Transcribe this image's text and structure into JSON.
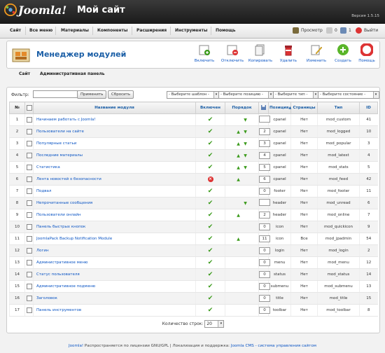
{
  "header": {
    "logo_text": "Joomla!",
    "site_title": "Мой сайт",
    "version": "Версия 1.5.15"
  },
  "menu": [
    "Сайт",
    "Все меню",
    "Материалы",
    "Компоненты",
    "Расширения",
    "Инструменты",
    "Помощь"
  ],
  "menu_right": {
    "preview": "Просмотр",
    "count0": "0",
    "count1": "1",
    "logout": "Выйти"
  },
  "toolbar": {
    "title": "Менеджер модулей",
    "buttons": [
      "Включить",
      "Отключить",
      "Копировать",
      "Удалить",
      "Изменить",
      "Создать",
      "Помощь"
    ]
  },
  "subnav": [
    "Сайт",
    "Административная панель"
  ],
  "filter": {
    "label": "Фильтр:",
    "value": "",
    "apply": "Применить",
    "reset": "Сбросить",
    "selects": [
      "- Выберите шаблон -",
      "- Выберите позицию -",
      "- Выберите тип -",
      "- Выберите состояние -"
    ]
  },
  "table": {
    "headers": {
      "num": "№",
      "name": "Название модуля",
      "enabled": "Включен",
      "order": "Порядок",
      "position": "Позиция",
      "pages": "Страницы",
      "type": "Тип",
      "id": "ID"
    },
    "rows": [
      {
        "n": "1",
        "name": "Начинаем работать с Joomla!",
        "enabled": true,
        "up": false,
        "down": true,
        "order": "",
        "position": "cpanel",
        "pages": "Нет",
        "type": "mod_custom",
        "id": "41"
      },
      {
        "n": "2",
        "name": "Пользователи на сайте",
        "enabled": true,
        "up": true,
        "down": true,
        "order": "2",
        "position": "cpanel",
        "pages": "Нет",
        "type": "mod_logged",
        "id": "10"
      },
      {
        "n": "3",
        "name": "Популярные статьи",
        "enabled": true,
        "up": true,
        "down": true,
        "order": "3",
        "position": "cpanel",
        "pages": "Нет",
        "type": "mod_popular",
        "id": "3"
      },
      {
        "n": "4",
        "name": "Последние материалы",
        "enabled": true,
        "up": true,
        "down": true,
        "order": "4",
        "position": "cpanel",
        "pages": "Нет",
        "type": "mod_latest",
        "id": "4"
      },
      {
        "n": "5",
        "name": "Статистика",
        "enabled": true,
        "up": true,
        "down": true,
        "order": "5",
        "position": "cpanel",
        "pages": "Нет",
        "type": "mod_stats",
        "id": "5"
      },
      {
        "n": "6",
        "name": "Лента новостей о безопасности",
        "enabled": false,
        "up": true,
        "down": false,
        "order": "6",
        "position": "cpanel",
        "pages": "Нет",
        "type": "mod_feed",
        "id": "42"
      },
      {
        "n": "7",
        "name": "Подвал",
        "enabled": true,
        "up": false,
        "down": false,
        "order": "0",
        "position": "footer",
        "pages": "Нет",
        "type": "mod_footer",
        "id": "11"
      },
      {
        "n": "8",
        "name": "Непрочитанные сообщения",
        "enabled": true,
        "up": false,
        "down": true,
        "order": "",
        "position": "header",
        "pages": "Нет",
        "type": "mod_unread",
        "id": "6"
      },
      {
        "n": "9",
        "name": "Пользователи онлайн",
        "enabled": true,
        "up": true,
        "down": false,
        "order": "2",
        "position": "header",
        "pages": "Нет",
        "type": "mod_online",
        "id": "7"
      },
      {
        "n": "10",
        "name": "Панель быстрых кнопок",
        "enabled": true,
        "up": false,
        "down": false,
        "order": "0",
        "position": "icon",
        "pages": "Нет",
        "type": "mod_quickicon",
        "id": "9"
      },
      {
        "n": "11",
        "name": "JoomlaPack Backup Notification Module",
        "enabled": true,
        "up": true,
        "down": false,
        "order": "11",
        "position": "icon",
        "pages": "Все",
        "type": "mod_jpadmin",
        "id": "54"
      },
      {
        "n": "12",
        "name": "Логин",
        "enabled": true,
        "up": false,
        "down": false,
        "order": "0",
        "position": "login",
        "pages": "Нет",
        "type": "mod_login",
        "id": "2"
      },
      {
        "n": "13",
        "name": "Административное меню",
        "enabled": true,
        "up": false,
        "down": false,
        "order": "0",
        "position": "menu",
        "pages": "Нет",
        "type": "mod_menu",
        "id": "12"
      },
      {
        "n": "14",
        "name": "Статус пользователя",
        "enabled": true,
        "up": false,
        "down": false,
        "order": "0",
        "position": "status",
        "pages": "Нет",
        "type": "mod_status",
        "id": "14"
      },
      {
        "n": "15",
        "name": "Административное подменю",
        "enabled": true,
        "up": false,
        "down": false,
        "order": "0",
        "position": "submenu",
        "pages": "Нет",
        "type": "mod_submenu",
        "id": "13"
      },
      {
        "n": "16",
        "name": "Заголовок",
        "enabled": true,
        "up": false,
        "down": false,
        "order": "0",
        "position": "title",
        "pages": "Нет",
        "type": "mod_title",
        "id": "15"
      },
      {
        "n": "17",
        "name": "Панель инструментов",
        "enabled": true,
        "up": false,
        "down": false,
        "order": "0",
        "position": "toolbar",
        "pages": "Нет",
        "type": "mod_toolbar",
        "id": "8"
      }
    ]
  },
  "pagination": {
    "label": "Количество строк:",
    "value": "20"
  },
  "footer": {
    "link1": "Joomla!",
    "text1": " Распространяется по лицензии GNU/GPL | Локализация и поддержка: ",
    "link2": "Joomla CMS - система управления сайтом"
  },
  "colors": {
    "accent": "#1a5ea6",
    "link": "#0b55c4",
    "enabled": "#3a9a1a",
    "disabled": "#dd3333"
  }
}
